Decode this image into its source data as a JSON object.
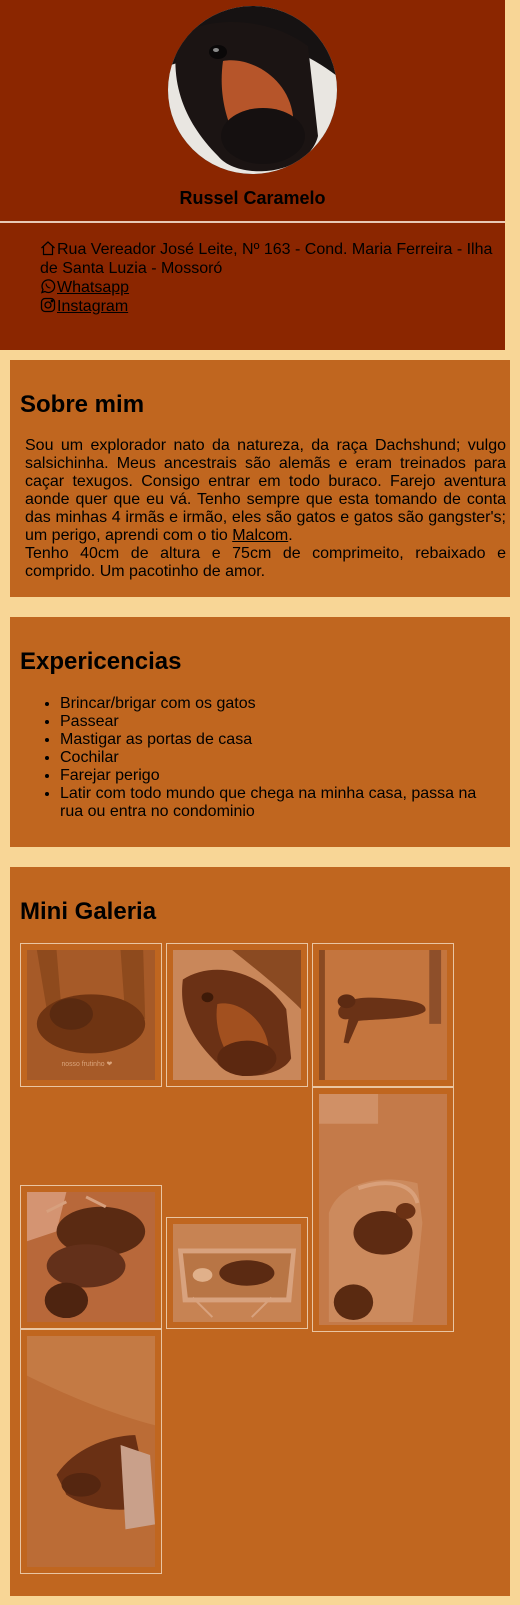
{
  "profile": {
    "name": "Russel Caramelo",
    "address": "Rua Vereador José Leite, Nº 163 - Cond. Maria Ferreira - Ilha de Santa Luzia - Mossoró",
    "whatsapp_label": "Whatsapp",
    "instagram_label": "Instagram"
  },
  "about": {
    "title": "Sobre mim",
    "text_before_link": "Sou um explorador nato da natureza, da raça Dachshund; vulgo salsichinha. Meus ancestrais são alemãs e eram treinados para caçar texugos. Consigo entrar em todo buraco. Farejo aventura aonde quer que eu vá. Tenho sempre que esta tomando de conta das minhas 4 irmãs e irmão, eles são gatos e gatos são gangster's; um perigo, aprendi com o tio ",
    "link_label": "Malcom",
    "text_after_link": ".",
    "text_second": "Tenho 40cm de altura e 75cm de comprimeito, rebaixado e comprido. Um pacotinho de amor."
  },
  "experiences": {
    "title": "Expericencias",
    "items": [
      "Brincar/brigar com os gatos",
      "Passear",
      "Mastigar as portas de casa",
      "Cochilar",
      "Farejar perigo",
      "Latir com todo mundo que chega na minha casa, passa na rua ou entra no condominio"
    ]
  },
  "gallery": {
    "title": "Mini Galeria",
    "photo1_caption": "nosso frutinho ❤"
  },
  "colors": {
    "page_bg": "#f8d696",
    "header_bg": "#8b2600",
    "card_bg": "#c0661f",
    "photo_border": "#e9c5a2"
  }
}
